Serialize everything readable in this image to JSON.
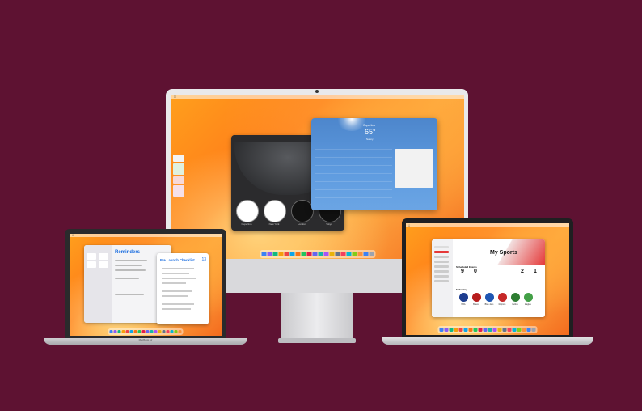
{
  "imac": {
    "weather": {
      "city": "Cupertino",
      "temp": "65°",
      "condition": "Sunny"
    },
    "clock_cities": [
      "Cupertino",
      "New York",
      "London",
      "Tokyo"
    ]
  },
  "macbook_air": {
    "badge": "MacBook Air",
    "reminders_title": "Reminders",
    "checklist_title": "Pre Launch Checklist",
    "checklist_count": "13"
  },
  "macbook_pro": {
    "sports_title": "My Sports",
    "section_scheduled": "Scheduled Events",
    "section_following": "Following",
    "scores": [
      "9",
      "0",
      "2",
      "1"
    ],
    "teams": [
      "NBA",
      "Braves",
      "Blue Jays",
      "Raptors",
      "Celtics",
      "Eagles"
    ]
  },
  "colors": {
    "background": "#5e1232",
    "accent": "#1d6fe0",
    "sports_red": "#e53838"
  },
  "dock_colors": [
    "#3b82f6",
    "#8b5cf6",
    "#10b981",
    "#f59e0b",
    "#ef4444",
    "#0ea5e9",
    "#f97316",
    "#22c55e",
    "#e11d48",
    "#6366f1",
    "#14b8a6",
    "#a855f7",
    "#eab308",
    "#64748b",
    "#f43f5e",
    "#06b6d4",
    "#84cc16",
    "#fb923c",
    "#3b82f6",
    "#9ca3af"
  ]
}
